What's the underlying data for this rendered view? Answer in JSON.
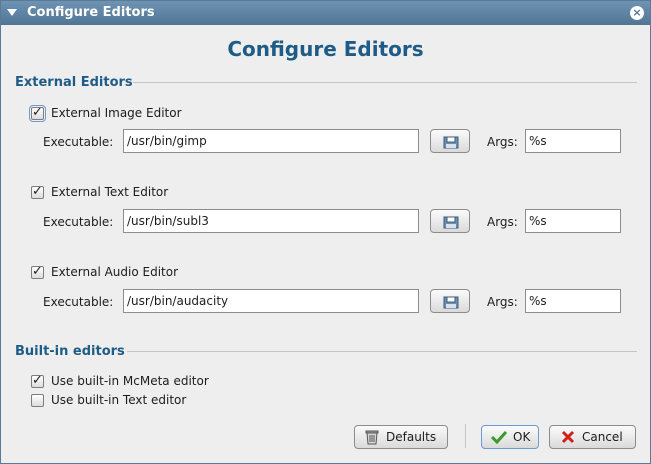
{
  "window": {
    "title": "Configure Editors"
  },
  "heading": "Configure Editors",
  "external": {
    "section_label": "External Editors",
    "editors": [
      {
        "label": "External Image Editor",
        "checked": true,
        "executable_label": "Executable:",
        "executable": "/usr/bin/gimp",
        "args_label": "Args:",
        "args": "%s"
      },
      {
        "label": "External Text Editor",
        "checked": true,
        "executable_label": "Executable:",
        "executable": "/usr/bin/subl3",
        "args_label": "Args:",
        "args": "%s"
      },
      {
        "label": "External Audio Editor",
        "checked": true,
        "executable_label": "Executable:",
        "executable": "/usr/bin/audacity",
        "args_label": "Args:",
        "args": "%s"
      }
    ]
  },
  "builtin": {
    "section_label": "Built-in editors",
    "options": [
      {
        "label": "Use built-in McMeta editor",
        "checked": true
      },
      {
        "label": "Use built-in Text editor",
        "checked": false
      }
    ]
  },
  "buttons": {
    "defaults": "Defaults",
    "ok": "OK",
    "cancel": "Cancel"
  },
  "colors": {
    "title_bar": "#5a7fa0",
    "accent": "#1e5c87",
    "ok_green": "#3a9a2a",
    "cancel_red": "#d0201a"
  },
  "icons": {
    "menu": "chevron-down-icon",
    "close": "close-icon",
    "browse": "folder-icon",
    "defaults": "trash-icon",
    "ok": "checkmark-icon",
    "cancel": "x-icon"
  }
}
